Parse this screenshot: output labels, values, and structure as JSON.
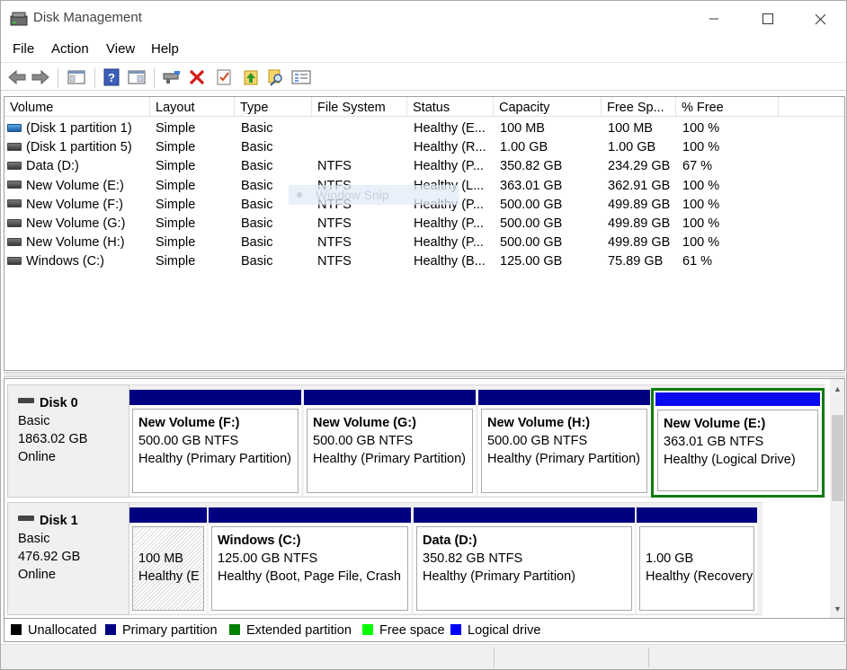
{
  "window": {
    "title": "Disk Management",
    "minimize_icon": "minimize-icon",
    "maximize_icon": "maximize-icon",
    "close_icon": "close-icon"
  },
  "menu": [
    "File",
    "Action",
    "View",
    "Help"
  ],
  "toolbar": {
    "buttons": [
      "back-arrow-icon",
      "forward-arrow-icon",
      "console-tree-icon",
      "help-icon",
      "properties-icon",
      "connect-icon",
      "delete-icon",
      "checklist-icon",
      "upload-icon",
      "search-icon",
      "settings-list-icon"
    ]
  },
  "volume_list": {
    "columns": [
      "Volume",
      "Layout",
      "Type",
      "File System",
      "Status",
      "Capacity",
      "Free Sp...",
      "% Free"
    ],
    "rows": [
      {
        "volume": "(Disk 1 partition 1)",
        "layout": "Simple",
        "type": "Basic",
        "fs": "",
        "status": "Healthy (E...",
        "capacity": "100 MB",
        "free": "100 MB",
        "pct": "100 %",
        "icon": "blue"
      },
      {
        "volume": "(Disk 1 partition 5)",
        "layout": "Simple",
        "type": "Basic",
        "fs": "",
        "status": "Healthy (R...",
        "capacity": "1.00 GB",
        "free": "1.00 GB",
        "pct": "100 %",
        "icon": "gray"
      },
      {
        "volume": "Data (D:)",
        "layout": "Simple",
        "type": "Basic",
        "fs": "NTFS",
        "status": "Healthy (P...",
        "capacity": "350.82 GB",
        "free": "234.29 GB",
        "pct": "67 %",
        "icon": "gray"
      },
      {
        "volume": "New Volume (E:)",
        "layout": "Simple",
        "type": "Basic",
        "fs": "NTFS",
        "status": "Healthy (L...",
        "capacity": "363.01 GB",
        "free": "362.91 GB",
        "pct": "100 %",
        "icon": "gray"
      },
      {
        "volume": "New Volume (F:)",
        "layout": "Simple",
        "type": "Basic",
        "fs": "NTFS",
        "status": "Healthy (P...",
        "capacity": "500.00 GB",
        "free": "499.89 GB",
        "pct": "100 %",
        "icon": "gray"
      },
      {
        "volume": "New Volume (G:)",
        "layout": "Simple",
        "type": "Basic",
        "fs": "NTFS",
        "status": "Healthy (P...",
        "capacity": "500.00 GB",
        "free": "499.89 GB",
        "pct": "100 %",
        "icon": "gray"
      },
      {
        "volume": "New Volume (H:)",
        "layout": "Simple",
        "type": "Basic",
        "fs": "NTFS",
        "status": "Healthy (P...",
        "capacity": "500.00 GB",
        "free": "499.89 GB",
        "pct": "100 %",
        "icon": "gray"
      },
      {
        "volume": "Windows (C:)",
        "layout": "Simple",
        "type": "Basic",
        "fs": "NTFS",
        "status": "Healthy (B...",
        "capacity": "125.00 GB",
        "free": "75.89 GB",
        "pct": "61 %",
        "icon": "gray"
      }
    ]
  },
  "overlay": {
    "snip_label": "Window Snip"
  },
  "disks": [
    {
      "name": "Disk 0",
      "type": "Basic",
      "size": "1863.02 GB",
      "state": "Online",
      "partitions": [
        {
          "name": "New Volume  (F:)",
          "detail": "500.00 GB NTFS",
          "status": "Healthy (Primary Partition)"
        },
        {
          "name": "New Volume  (G:)",
          "detail": "500.00 GB NTFS",
          "status": "Healthy (Primary Partition)"
        },
        {
          "name": "New Volume  (H:)",
          "detail": "500.00 GB NTFS",
          "status": "Healthy (Primary Partition)"
        },
        {
          "name": "New Volume  (E:)",
          "detail": "363.01 GB NTFS",
          "status": "Healthy (Logical Drive)"
        }
      ]
    },
    {
      "name": "Disk 1",
      "type": "Basic",
      "size": "476.92 GB",
      "state": "Online",
      "partitions": [
        {
          "name": "",
          "detail": "100 MB",
          "status": "Healthy (E"
        },
        {
          "name": "Windows  (C:)",
          "detail": "125.00 GB NTFS",
          "status": "Healthy (Boot, Page File, Crash"
        },
        {
          "name": "Data  (D:)",
          "detail": "350.82 GB NTFS",
          "status": "Healthy (Primary Partition)"
        },
        {
          "name": "",
          "detail": "1.00 GB",
          "status": "Healthy (Recovery"
        }
      ]
    }
  ],
  "legend": [
    {
      "label": "Unallocated",
      "color": "#000000"
    },
    {
      "label": "Primary partition",
      "color": "#000080"
    },
    {
      "label": "Extended partition",
      "color": "#008000"
    },
    {
      "label": "Free space",
      "color": "#00ff00"
    },
    {
      "label": "Logical drive",
      "color": "#0000ff"
    }
  ],
  "colors": {
    "primary": "#000080",
    "logical": "#0a0af0",
    "selection": "#0f7b0f"
  }
}
